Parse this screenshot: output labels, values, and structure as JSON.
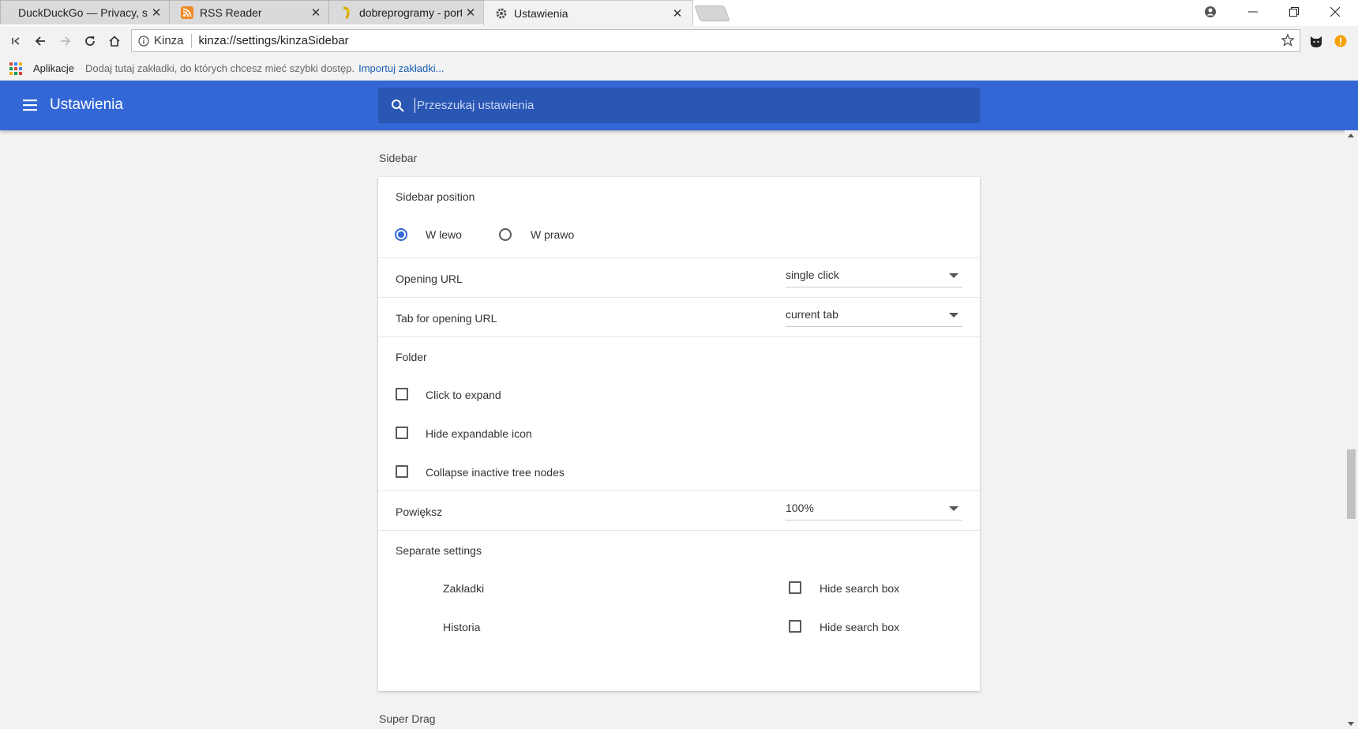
{
  "tabs": [
    {
      "title": "DuckDuckGo — Privacy, simp",
      "icon": "duckduckgo-favicon"
    },
    {
      "title": "RSS Reader",
      "icon": "rss-icon"
    },
    {
      "title": "dobreprogramy - portal r",
      "icon": "dobreprogramy-favicon"
    },
    {
      "title": "Ustawienia",
      "icon": "gear-icon",
      "active": true
    }
  ],
  "omnibox": {
    "site": "Kinza",
    "url": "kinza://settings/kinzaSidebar"
  },
  "bookmarks_bar": {
    "apps_label": "Aplikacje",
    "hint": "Dodaj tutaj zakładki, do których chcesz mieć szybki dostęp.",
    "import_link": "Importuj zakładki..."
  },
  "header": {
    "title": "Ustawienia",
    "search_placeholder": "Przeszukaj ustawienia"
  },
  "sidebar_section": {
    "title": "Sidebar",
    "position": {
      "label": "Sidebar position",
      "options": [
        "W lewo",
        "W prawo"
      ],
      "selected": "W lewo"
    },
    "opening_url": {
      "label": "Opening URL",
      "value": "single click"
    },
    "tab_for_opening": {
      "label": "Tab for opening URL",
      "value": "current tab"
    },
    "folder": {
      "label": "Folder",
      "options": [
        {
          "label": "Click to expand",
          "checked": false
        },
        {
          "label": "Hide expandable icon",
          "checked": false
        },
        {
          "label": "Collapse inactive tree nodes",
          "checked": false
        }
      ]
    },
    "zoom": {
      "label": "Powiększ",
      "value": "100%"
    },
    "separate": {
      "label": "Separate settings",
      "rows": [
        {
          "name": "Zakładki",
          "option": "Hide search box",
          "checked": false
        },
        {
          "name": "Historia",
          "option": "Hide search box",
          "checked": false
        }
      ]
    }
  },
  "next_section": {
    "title": "Super Drag"
  },
  "colors": {
    "header_bg": "#3367d6",
    "search_bg": "#2a56b4",
    "accent": "#3367d6"
  }
}
